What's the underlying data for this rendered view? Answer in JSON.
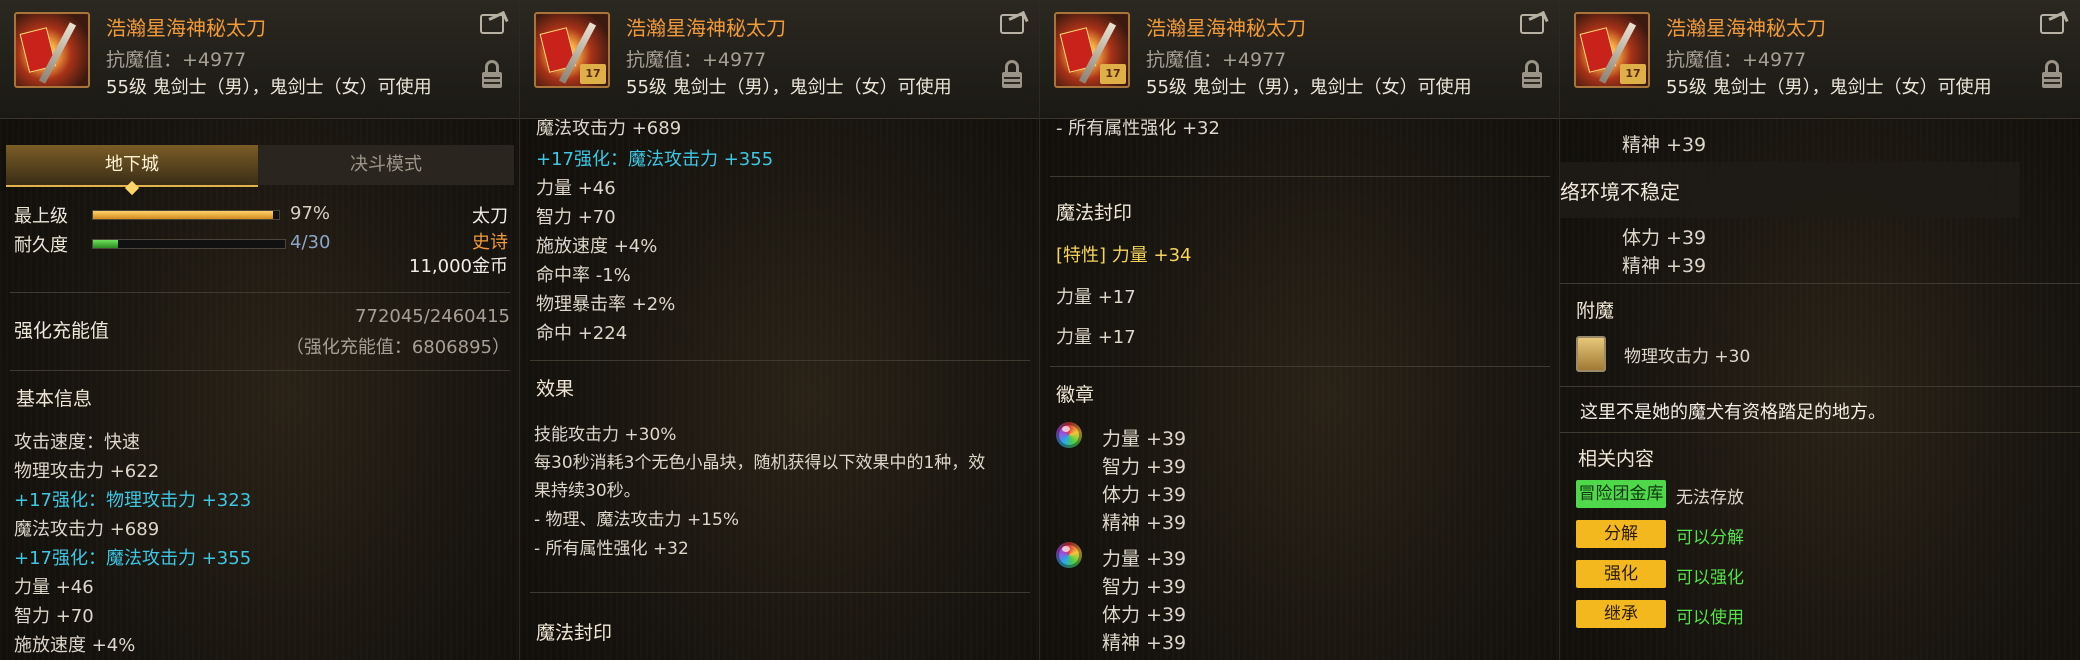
{
  "item": {
    "name": "浩瀚星海神秘太刀",
    "resist": "抗魔值：+4977",
    "usable": "55级 鬼剑士（男），鬼剑士（女）可使用",
    "icon_badge": "17"
  },
  "panel1": {
    "tabs": [
      "地下城",
      "决斗模式"
    ],
    "level_label": "最上级",
    "level_value": "97%",
    "level_progress": 0.97,
    "durability_label": "耐久度",
    "durability_value": "4/30",
    "durability_progress": 0.13,
    "weapon_type": "太刀",
    "rarity": "史诗",
    "price": "11,000金币",
    "charge_label": "强化充能值",
    "charge_value": "772045/2460415",
    "charge_total": "（强化充能值：6806895）",
    "basic_title": "基本信息",
    "stats": [
      "攻击速度：快速",
      "物理攻击力 +622",
      "+17强化：物理攻击力 +323",
      "魔法攻击力 +689",
      "+17强化：魔法攻击力 +355",
      "力量 +46",
      "智力 +70",
      "施放速度 +4%"
    ]
  },
  "panel2": {
    "top_cut": "魔法攻击力 +689",
    "stats": [
      "+17强化：魔法攻击力 +355",
      "力量 +46",
      "智力 +70",
      "施放速度 +4%",
      "命中率 -1%",
      "物理暴击率 +2%",
      "命中 +224"
    ],
    "effect_title": "效果",
    "effects": [
      "技能攻击力 +30%",
      "每30秒消耗3个无色小晶块，随机获得以下效果中的1种，效",
      "果持续30秒。",
      "- 物理、魔法攻击力 +15%",
      "- 所有属性强化 +32"
    ],
    "seal_title": "魔法封印"
  },
  "panel3": {
    "top_cut": "- 所有属性强化 +32",
    "seal_title": "魔法封印",
    "seal_trait_prefix": "[特性]",
    "seal_trait": "力量 +34",
    "seal_lines": [
      "力量 +17",
      "力量 +17"
    ],
    "emblem_title": "徽章",
    "emblem_group1": [
      "力量 +39",
      "智力 +39",
      "体力 +39",
      "精神 +39"
    ],
    "emblem_group2": [
      "力量 +39",
      "智力 +39",
      "体力 +39",
      "精神 +39"
    ]
  },
  "panel4": {
    "top_line": "精神 +39",
    "network_warning": "络环境不稳定",
    "lines": [
      "体力 +39",
      "精神 +39"
    ],
    "enchant_title": "附魔",
    "enchant_value": "物理攻击力 +30",
    "flavor": "这里不是她的魔犬有资格踏足的地方。",
    "related_title": "相关内容",
    "related": [
      {
        "button": "冒险团金库",
        "status": "无法存放"
      },
      {
        "button": "分解",
        "status": "可以分解"
      },
      {
        "button": "强化",
        "status": "可以强化"
      },
      {
        "button": "继承",
        "status": "可以使用"
      }
    ]
  }
}
